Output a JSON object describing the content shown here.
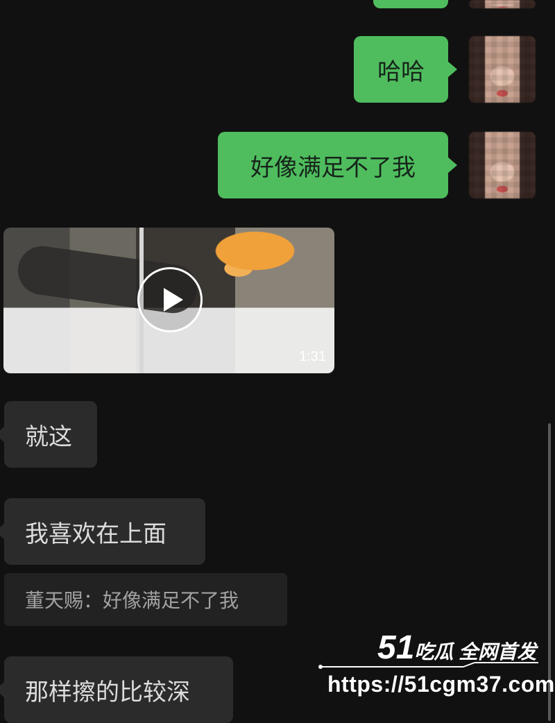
{
  "messages": {
    "haha": "哈哈",
    "cant_satisfy": "好像满足不了我",
    "video_duration": "1:31",
    "just_this": "就这",
    "like_on_top": "我喜欢在上面",
    "quote": "董天赐：好像满足不了我",
    "rub_deeper": "那样擦的比较深"
  },
  "watermark": {
    "num": "51",
    "brand": "吃瓜 全网首发",
    "url": "https://51cgm37.com"
  },
  "colors": {
    "background": "#111111",
    "outgoing_bubble": "#4fbd5e",
    "incoming_bubble": "#2b2b2b"
  }
}
